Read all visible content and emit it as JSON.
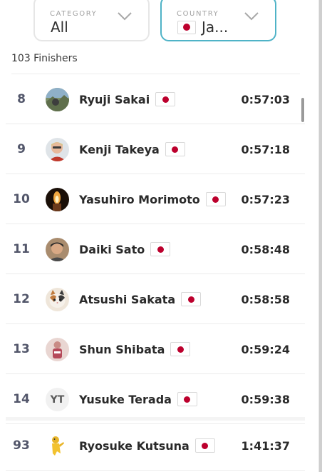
{
  "filters": {
    "category": {
      "label": "CATEGORY",
      "value": "All"
    },
    "country": {
      "label": "COUNTRY",
      "value": "Ja...",
      "flag": "japan-flag"
    }
  },
  "finishers_count": "103 Finishers",
  "results": [
    {
      "rank": "8",
      "name": "Ryuji Sakai",
      "time": "0:57:03",
      "avatar": "photo-landscape",
      "flag": "japan-flag"
    },
    {
      "rank": "9",
      "name": "Kenji Takeya",
      "time": "0:57:18",
      "avatar": "photo-person",
      "flag": "japan-flag"
    },
    {
      "rank": "10",
      "name": "Yasuhiro Morimoto",
      "time": "0:57:23",
      "avatar": "photo-candle",
      "flag": "japan-flag"
    },
    {
      "rank": "11",
      "name": "Daiki Sato",
      "time": "0:58:48",
      "avatar": "photo-person",
      "flag": "japan-flag"
    },
    {
      "rank": "12",
      "name": "Atsushi Sakata",
      "time": "0:58:58",
      "avatar": "photo-cat",
      "flag": "japan-flag"
    },
    {
      "rank": "13",
      "name": "Shun Shibata",
      "time": "0:59:24",
      "avatar": "photo-figure",
      "flag": "japan-flag"
    },
    {
      "rank": "14",
      "name": "Yusuke Terada",
      "time": "0:59:38",
      "avatar": "YT",
      "flag": "japan-flag"
    },
    {
      "rank": "93",
      "name": "Ryosuke Kutsuna",
      "time": "1:41:37",
      "avatar": "photo-yellow-figure",
      "flag": "japan-flag"
    }
  ],
  "colors": {
    "accent": "#4fb3c7",
    "rank_text": "#52566a",
    "flag_red": "#bc002d",
    "divider": "#ececec"
  }
}
